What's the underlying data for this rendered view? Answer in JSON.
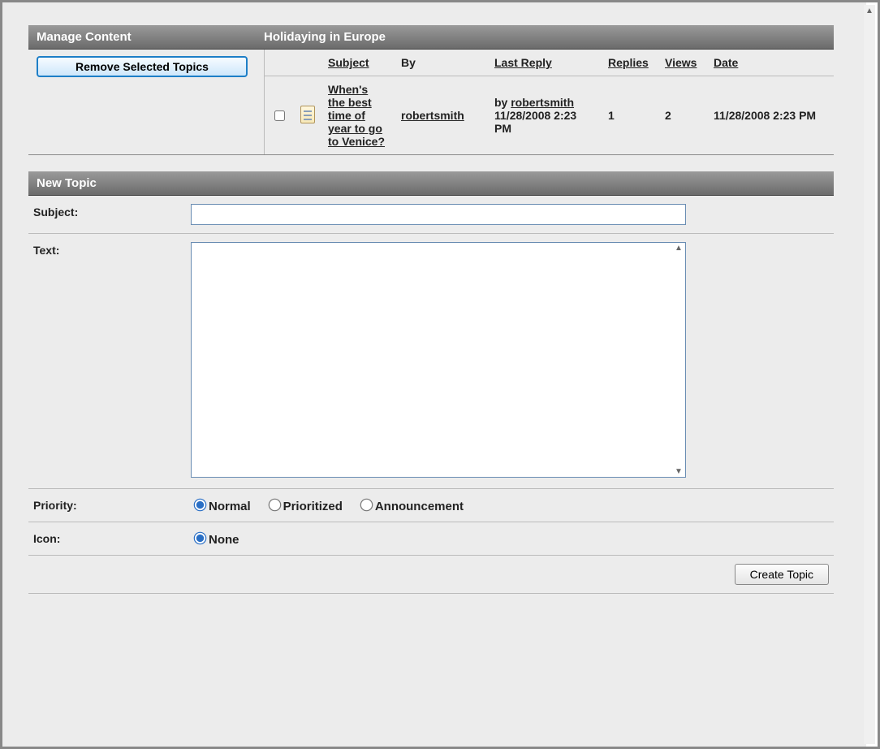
{
  "header": {
    "left_title": "Manage Content",
    "right_title": "Holidaying in Europe"
  },
  "sidebar": {
    "remove_button_label": "Remove Selected Topics"
  },
  "table": {
    "headers": {
      "subject": "Subject",
      "by": "By",
      "last_reply": "Last Reply",
      "replies": "Replies",
      "views": "Views",
      "date": "Date"
    },
    "rows": [
      {
        "subject": "When's the best time of year to go to Venice?",
        "by": "robertsmith",
        "last_reply_by_prefix": "by",
        "last_reply_by": "robertsmith",
        "last_reply_date": "11/28/2008 2:23 PM",
        "replies": "1",
        "views": "2",
        "date": "11/28/2008 2:23 PM"
      }
    ]
  },
  "new_topic": {
    "section_title": "New Topic",
    "subject_label": "Subject:",
    "subject_value": "",
    "text_label": "Text:",
    "text_value": "",
    "priority_label": "Priority:",
    "priority_options": {
      "normal": "Normal",
      "prioritized": "Prioritized",
      "announcement": "Announcement"
    },
    "icon_label": "Icon:",
    "icon_options": {
      "none": "None"
    },
    "submit_label": "Create Topic"
  }
}
